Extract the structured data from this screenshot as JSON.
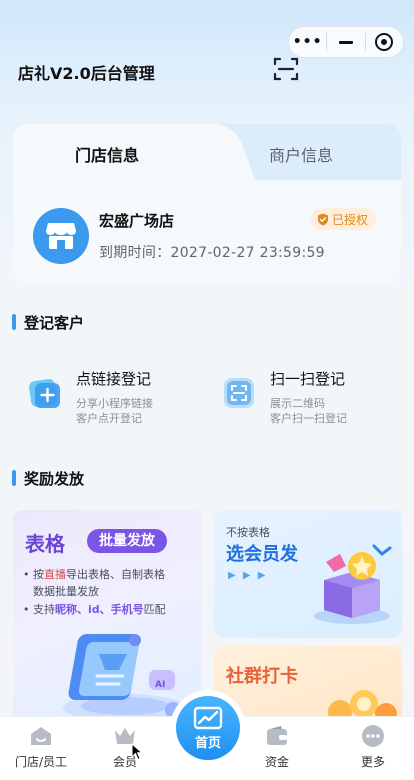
{
  "header": {
    "app_title": "店礼V2.0后台管理",
    "capsule": {
      "more": "•••"
    }
  },
  "store_card": {
    "tabs": [
      {
        "label": "门店信息",
        "active": true
      },
      {
        "label": "商户信息",
        "active": false
      }
    ],
    "store_name": "宏盛广场店",
    "expire_label": "到期时间：",
    "expire_value": "2027-02-27 23:59:59",
    "auth_badge": "已授权"
  },
  "register_section": {
    "title": "登记客户",
    "items": [
      {
        "title": "点链接登记",
        "sub1": "分享小程序链接",
        "sub2": "客户点开登记",
        "icon": "link-icon"
      },
      {
        "title": "扫一扫登记",
        "sub1": "展示二维码",
        "sub2": "客户扫一扫登记",
        "icon": "scan-icon"
      }
    ]
  },
  "reward_section": {
    "title": "奖励发放",
    "table_card": {
      "big_word": "表格",
      "pill": "批量发放",
      "line1_pre": "• 按",
      "line1_hl": "直播",
      "line1_post": "导出表格、自制表格",
      "line2": "数据批量发放",
      "line3_pre": "• 支持",
      "line3_hl": "昵称、id、手机号",
      "line3_post": "匹配",
      "ai": "AI"
    },
    "member_card": {
      "small": "不按表格",
      "big": "选会员发",
      "arrows": "▶ ▶ ▶"
    },
    "group_card": {
      "big": "社群打卡"
    }
  },
  "bottom_nav": {
    "items": [
      {
        "label": "门店/员工",
        "icon": "store-staff-icon"
      },
      {
        "label": "会员",
        "icon": "crown-icon"
      },
      {
        "label": "首页",
        "icon": "chart-icon"
      },
      {
        "label": "资金",
        "icon": "wallet-icon"
      },
      {
        "label": "更多",
        "icon": "more-icon"
      }
    ]
  },
  "colors": {
    "primary": "#3b9af0",
    "purple": "#7a55e6",
    "orange": "#e08a1e",
    "red": "#e04646"
  }
}
